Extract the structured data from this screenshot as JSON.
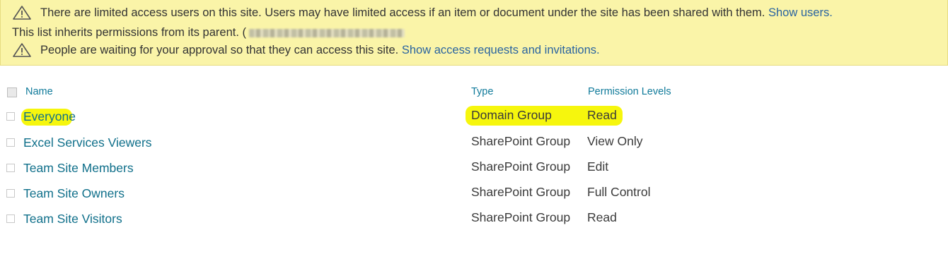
{
  "banner": {
    "limited_text": "There are limited access users on this site. Users may have limited access if an item or document under the site has been shared with them.",
    "limited_link": "Show users.",
    "inherit_text": "This list inherits permissions from its parent.",
    "inherit_parent": "(",
    "approval_text": "People are waiting for your approval so that they can access this site.",
    "approval_link": "Show access requests and invitations."
  },
  "table": {
    "headers": {
      "name": "Name",
      "type": "Type",
      "permission": "Permission Levels"
    },
    "rows": [
      {
        "name": "Everyone",
        "type": "Domain Group",
        "permission": "Read",
        "highlighted": true
      },
      {
        "name": "Excel Services Viewers",
        "type": "SharePoint Group",
        "permission": "View Only",
        "highlighted": false
      },
      {
        "name": "Team Site Members",
        "type": "SharePoint Group",
        "permission": "Edit",
        "highlighted": false
      },
      {
        "name": "Team Site Owners",
        "type": "SharePoint Group",
        "permission": "Full Control",
        "highlighted": false
      },
      {
        "name": "Team Site Visitors",
        "type": "SharePoint Group",
        "permission": "Read",
        "highlighted": false
      }
    ]
  },
  "colors": {
    "banner_bg": "#faf4a8",
    "link": "#2a64a0",
    "name_link": "#0f6f8a",
    "highlight": "#f5f500"
  },
  "icons": {
    "warning": "warning-triangle-icon"
  }
}
